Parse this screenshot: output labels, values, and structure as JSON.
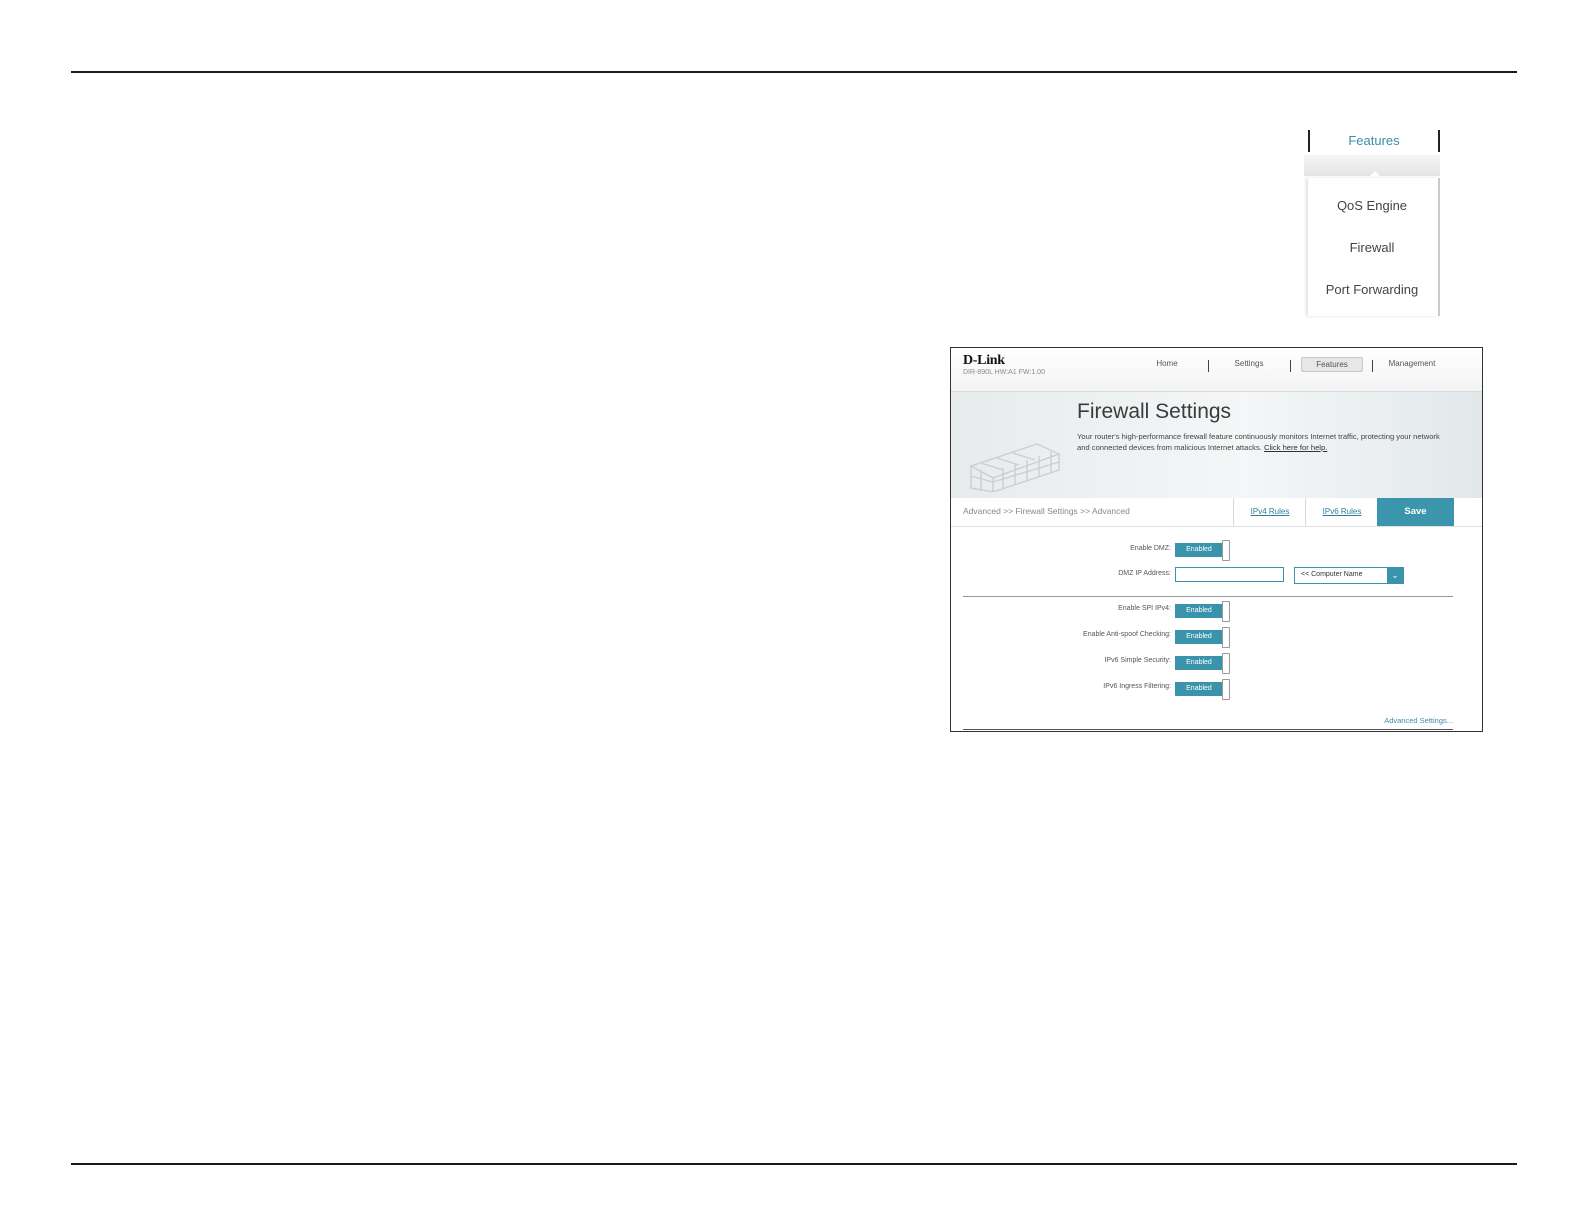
{
  "features_menu": {
    "tab_label": "Features",
    "items": [
      "QoS Engine",
      "Firewall",
      "Port Forwarding"
    ]
  },
  "router_ui": {
    "brand": "D-Link",
    "model_info": "DIR-890L   HW:A1   FW:1.00",
    "nav": [
      "Home",
      "Settings",
      "Features",
      "Management"
    ],
    "active_nav": "Features",
    "title": "Firewall Settings",
    "description": "Your router's high-performance firewall feature continuously monitors Internet traffic, protecting your network and connected devices from malicious Internet attacks.",
    "help_link": "Click here for help.",
    "breadcrumb": "Advanced >> Firewall Settings >> Advanced",
    "ipv4_rules": "IPv4 Rules",
    "ipv6_rules": "IPv6 Rules",
    "save": "Save",
    "settings": [
      {
        "label": "Enable DMZ:",
        "value": "Enabled"
      },
      {
        "label": "Enable SPI IPv4:",
        "value": "Enabled"
      },
      {
        "label": "Enable Anti-spoof Checking:",
        "value": "Enabled"
      },
      {
        "label": "IPv6 Simple Security:",
        "value": "Enabled"
      },
      {
        "label": "IPv6 Ingress Filtering:",
        "value": "Enabled"
      }
    ],
    "dmz_ip_label": "DMZ IP Address:",
    "dmz_ip_value": "",
    "computer_name_select": "<< Computer Name",
    "advanced_settings_link": "Advanced Settings..."
  },
  "colors": {
    "accent": "#3993ab",
    "link": "#2b7e95"
  }
}
